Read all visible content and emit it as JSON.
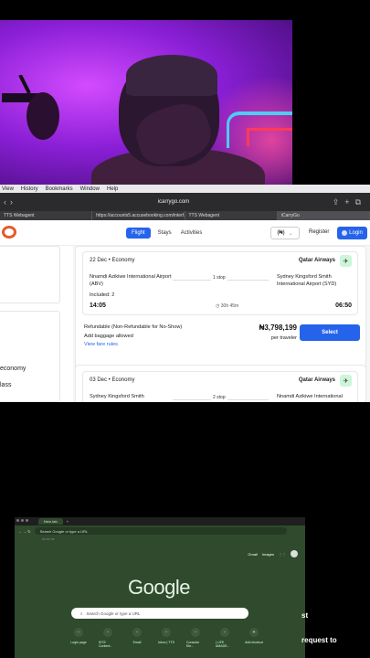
{
  "mac_menu": [
    "View",
    "History",
    "Bookmarks",
    "Window",
    "Help"
  ],
  "safari": {
    "address": "icarrygo.com",
    "tabs": [
      "TTS Webagent",
      "https://accounts5.accusebooking.com/interf...",
      "TTS Webagent",
      "iCarryGo"
    ]
  },
  "site": {
    "nav": {
      "flight": "Flight",
      "stays": "Stays",
      "activities": "Activities"
    },
    "currency": "(₦)",
    "register": "Register",
    "login": "Login"
  },
  "filters": {
    "option1": "economy",
    "option2": "lass"
  },
  "results": [
    {
      "date": "22 Dec",
      "cabin": "Economy",
      "airline": "Qatar Airways",
      "from": "Nnamdi Azikiwe International Airport (ABV)",
      "to": "Sydney Kingsford Smith International Airport (SYD)",
      "stops": "1 stop",
      "included": "Included: 2",
      "depart": "14:05",
      "duration": "30h 45m",
      "arrive": "06:50",
      "refund": "Refundable (Non-Refundable for No-Show)",
      "baggage": "Add baggage allowed",
      "fare_rules": "View fare rules",
      "price": "₦3,798,199",
      "per": "per traveler",
      "select": "Select"
    },
    {
      "date": "03 Dec",
      "cabin": "Economy",
      "airline": "Qatar Airways",
      "from": "Sydney Kingsford Smith",
      "to": "Nnamdi Azikiwe International",
      "stops": "2 stop"
    }
  ],
  "chrome": {
    "tab": "New tab",
    "omnibox_placeholder": "Search Google or type a URL",
    "top_links": [
      "Gmail",
      "Images"
    ],
    "logo": "Google",
    "search_placeholder": "Search Google or type a URL",
    "shortcuts": [
      "Login page",
      "SITE Content...",
      "Email",
      "Inbox | TTS",
      "Consular Ele...",
      "| LIFE AMADE...",
      "Add shortcut"
    ]
  },
  "overlay": {
    "line1": "st",
    "line2": "request to"
  }
}
